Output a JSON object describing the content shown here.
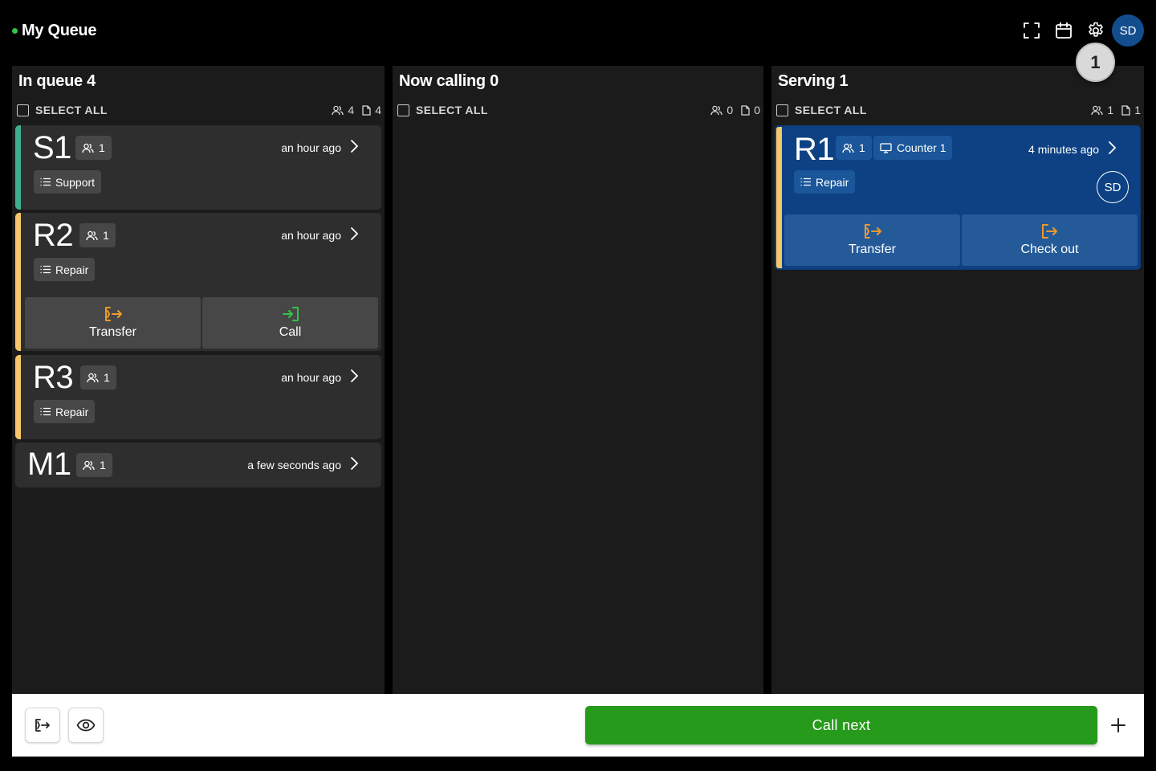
{
  "header": {
    "title": "My Queue",
    "status_color": "#33c24a",
    "icons": [
      "fullscreen-icon",
      "calendar-icon",
      "settings-icon"
    ],
    "user_initials": "SD",
    "step_badge": "1"
  },
  "columns": [
    {
      "title": "In queue 4",
      "select_all": "SELECT ALL",
      "people_count": "4",
      "doc_count": "4",
      "cards": [
        {
          "ticket": "S1",
          "people": "1",
          "time": "an hour ago",
          "service": "Support",
          "stripe_color": "#3fae8e"
        },
        {
          "ticket": "R2",
          "people": "1",
          "time": "an hour ago",
          "service": "Repair",
          "stripe_color": "#f5c76a",
          "actions": [
            "Transfer",
            "Call"
          ]
        },
        {
          "ticket": "R3",
          "people": "1",
          "time": "an hour ago",
          "service": "Repair",
          "stripe_color": "#f5c76a"
        },
        {
          "ticket": "M1",
          "people": "1",
          "time": "a few seconds ago"
        }
      ]
    },
    {
      "title": "Now calling 0",
      "select_all": "SELECT ALL",
      "people_count": "0",
      "doc_count": "0",
      "cards": []
    },
    {
      "title": "Serving 1",
      "select_all": "SELECT ALL",
      "people_count": "1",
      "doc_count": "1",
      "cards": [
        {
          "ticket": "R1",
          "people": "1",
          "counter": "Counter 1",
          "time": "4 minutes ago",
          "service": "Repair",
          "stripe_color": "#f5c76a",
          "assignee": "SD",
          "actions": [
            "Transfer",
            "Check out"
          ]
        }
      ]
    }
  ],
  "footer": {
    "call_next_label": "Call next",
    "icons": [
      "logout-icon",
      "eye-icon",
      "plus-icon"
    ]
  },
  "colors": {
    "call_next": "#269a1a",
    "serving_card": "#0d4183",
    "transfer_icon": "#f0992c",
    "call_icon": "#33c24a"
  }
}
